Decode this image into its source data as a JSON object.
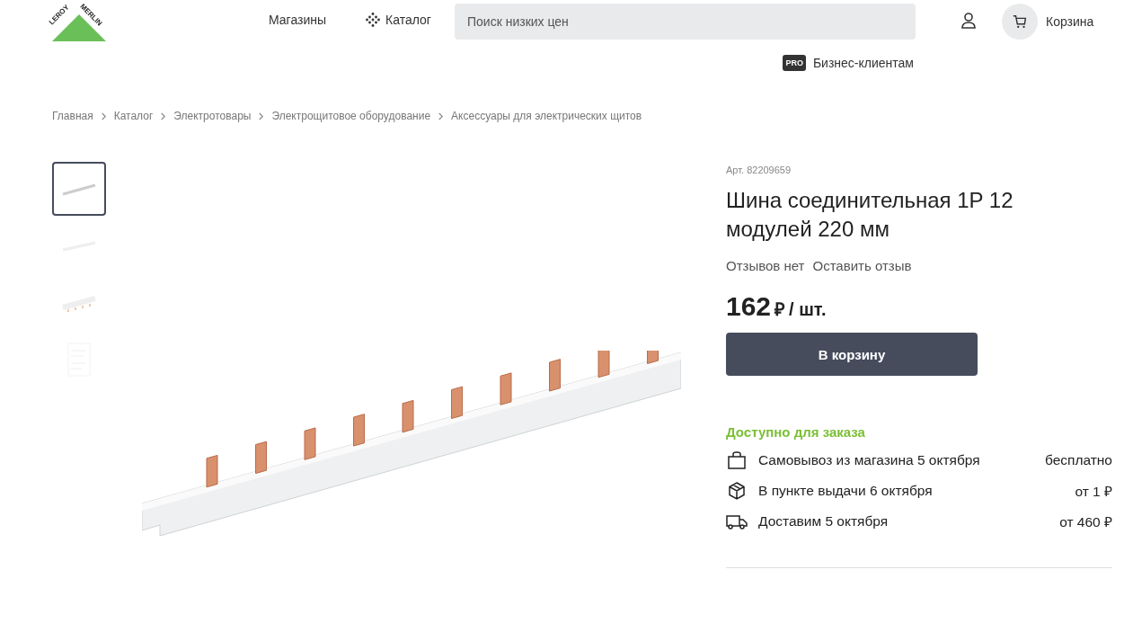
{
  "header": {
    "logo": [
      "LEROY",
      "MERLIN"
    ],
    "nav": [
      {
        "label": "Магазины",
        "kind": "text"
      },
      {
        "label": "Каталог",
        "kind": "catalog"
      }
    ],
    "search": {
      "placeholder": "Поиск низких цен"
    },
    "cart": "Корзина",
    "pro": {
      "badge": "PRO",
      "label": "Бизнес-клиентам"
    }
  },
  "breadcrumbs": [
    "Главная",
    "Каталог",
    "Электротовары",
    "Электрощитовое оборудование",
    "Аксессуары для электрических щитов"
  ],
  "thumbnails": [
    {
      "kind": "bar",
      "selected": true
    },
    {
      "kind": "bar-light",
      "selected": false
    },
    {
      "kind": "bar-pins",
      "selected": false
    },
    {
      "kind": "sheet",
      "selected": false
    }
  ],
  "product": {
    "article": "Арт. 82209659",
    "title": "Шина соединительная 1P 12 модулей 220 мм",
    "reviews": "Отзывов нет",
    "review_link": "Оставить отзыв",
    "price": "162",
    "currency": "₽",
    "unit": "/ шт.",
    "button": "В корзину"
  },
  "availability": {
    "title": "Доступно для заказа",
    "options": [
      {
        "kind": "bag",
        "label": "Самовывоз из магазина 5 октября",
        "price": "бесплатно"
      },
      {
        "kind": "box",
        "label": "В пункте выдачи 6 октября",
        "price": "от 1 ₽"
      },
      {
        "kind": "truck",
        "label": "Доставим 5 октября",
        "price": "от 460 ₽"
      }
    ]
  }
}
